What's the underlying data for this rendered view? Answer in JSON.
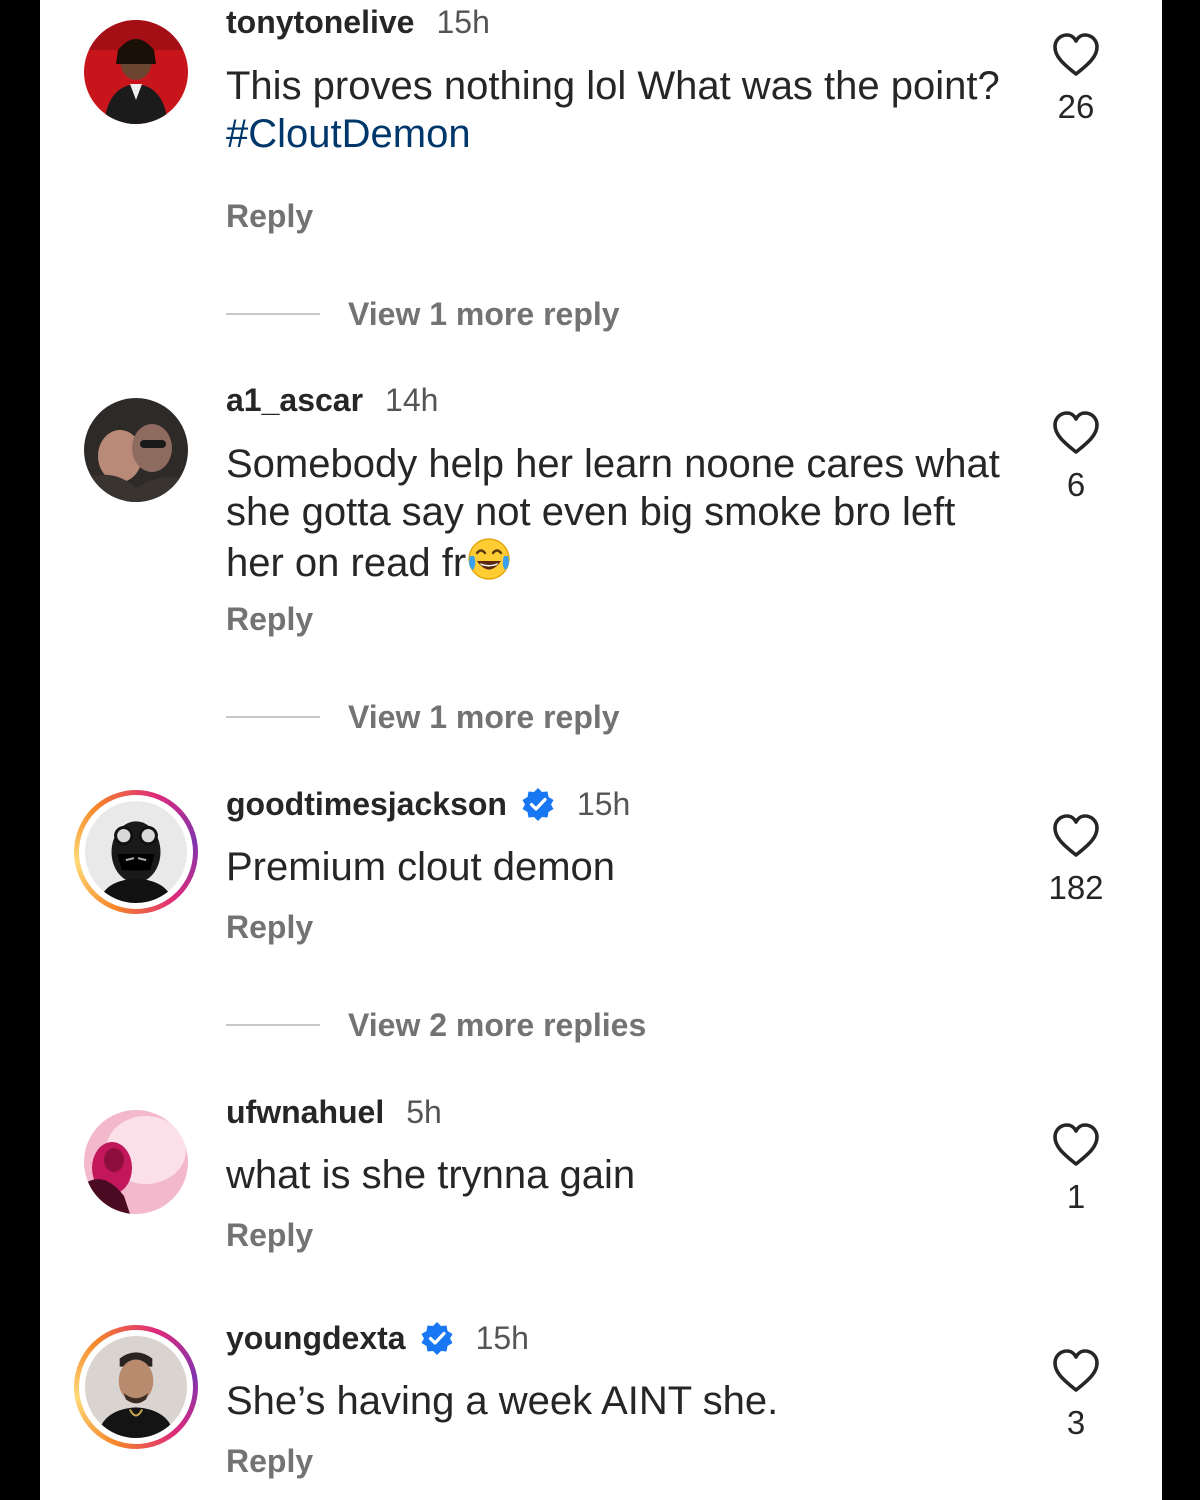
{
  "comments": [
    {
      "username": "tonytonelive",
      "time": "15h",
      "verified": false,
      "text": "This proves nothing lol What was the point?",
      "hashtag": "#CloutDemon",
      "reply_label": "Reply",
      "likes": "26",
      "view_more": "View 1 more reply"
    },
    {
      "username": "a1_ascar",
      "time": "14h",
      "verified": false,
      "text_lines": [
        "Somebody help her learn noone cares what",
        "she gotta say not even big smoke bro left",
        "her on read fr"
      ],
      "emoji": "face-with-tears-of-joy",
      "reply_label": "Reply",
      "likes": "6",
      "view_more": "View 1 more reply"
    },
    {
      "username": "goodtimesjackson",
      "time": "15h",
      "verified": true,
      "text": "Premium clout demon",
      "reply_label": "Reply",
      "likes": "182",
      "view_more": "View 2 more replies"
    },
    {
      "username": "ufwnahuel",
      "time": "5h",
      "verified": false,
      "text": "what is she trynna gain",
      "reply_label": "Reply",
      "likes": "1"
    },
    {
      "username": "youngdexta",
      "time": "15h",
      "verified": true,
      "text": "She’s having a week AINT she.",
      "reply_label": "Reply",
      "likes": "3"
    }
  ],
  "colors": {
    "text": "#262626",
    "secondary": "#737373",
    "hashtag": "#00376b",
    "verified": "#1877f2",
    "story_ring_start": "#f58529",
    "story_ring_end": "#dd2a7b"
  }
}
